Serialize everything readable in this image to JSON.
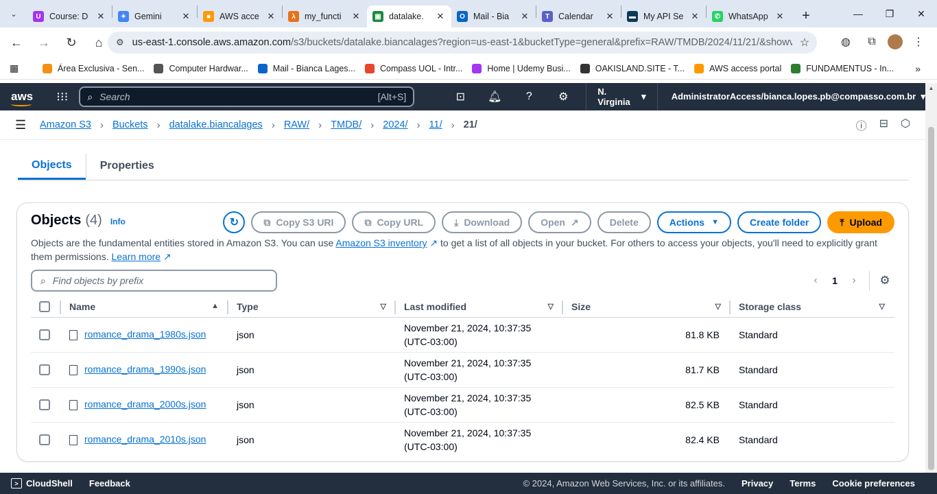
{
  "browser": {
    "tabs": [
      {
        "title": "Course: D",
        "color": "#a435f0",
        "glyph": "U"
      },
      {
        "title": "Gemini",
        "color": "#4285f4",
        "glyph": "✦"
      },
      {
        "title": "AWS acce",
        "color": "#ff9900",
        "glyph": "■"
      },
      {
        "title": "my_functi",
        "color": "#e7711b",
        "glyph": "λ"
      },
      {
        "title": "datalake.",
        "color": "#1b8a3e",
        "glyph": "▣"
      },
      {
        "title": "Mail - Bia",
        "color": "#0a64c8",
        "glyph": "O"
      },
      {
        "title": "Calendar",
        "color": "#5b5fc7",
        "glyph": "T"
      },
      {
        "title": "My API Se",
        "color": "#0c3b57",
        "glyph": "▬"
      },
      {
        "title": "WhatsApp",
        "color": "#25d366",
        "glyph": "✆"
      }
    ],
    "url_main": "us-east-1.console.aws.amazon.com",
    "url_rest": "/s3/buckets/datalake.biancalages?region=us-east-1&bucketType=general&prefix=RAW/TMDB/2024/11/21/&showve...",
    "bookmarks": [
      {
        "label": "Área Exclusiva - Sen...",
        "color": "#f29111"
      },
      {
        "label": "Computer Hardwar...",
        "color": "#555555"
      },
      {
        "label": "Mail - Bianca Lages...",
        "color": "#0a64c8"
      },
      {
        "label": "Compass UOL - Intr...",
        "color": "#e8452c"
      },
      {
        "label": "Home | Udemy Busi...",
        "color": "#a435f0"
      },
      {
        "label": "OAKISLAND.SITE - T...",
        "color": "#333333"
      },
      {
        "label": "AWS access portal",
        "color": "#ff9900"
      },
      {
        "label": "FUNDAMENTUS - In...",
        "color": "#2e7d32"
      }
    ]
  },
  "aws": {
    "logo": "aws",
    "search_placeholder": "Search",
    "search_shortcut": "[Alt+S]",
    "region": "N. Virginia",
    "account": "AdministratorAccess/bianca.lopes.pb@compasso.com.br"
  },
  "breadcrumbs": [
    "Amazon S3",
    "Buckets",
    "datalake.biancalages",
    "RAW/",
    "TMDB/",
    "2024/",
    "11/"
  ],
  "breadcrumb_current": "21/",
  "page_tabs": [
    "Objects",
    "Properties"
  ],
  "objects_panel": {
    "title": "Objects",
    "count": "(4)",
    "info": "Info",
    "buttons": {
      "copy_s3_uri": "Copy S3 URI",
      "copy_url": "Copy URL",
      "download": "Download",
      "open": "Open",
      "delete": "Delete",
      "actions": "Actions",
      "create_folder": "Create folder",
      "upload": "Upload"
    },
    "desc_1": "Objects are the fundamental entities stored in Amazon S3. You can use ",
    "desc_link_1": "Amazon S3 inventory",
    "desc_2": " to get a list of all objects in your bucket. For others to access your objects, you'll need to explicitly grant them permissions. ",
    "desc_link_2": "Learn more",
    "filter_placeholder": "Find objects by prefix",
    "page": "1",
    "columns": {
      "name": "Name",
      "type": "Type",
      "last_modified": "Last modified",
      "size": "Size",
      "storage_class": "Storage class"
    },
    "rows": [
      {
        "name": "romance_drama_1980s.json",
        "type": "json",
        "modified_1": "November 21, 2024, 10:37:35",
        "modified_2": "(UTC-03:00)",
        "size": "81.8 KB",
        "storage": "Standard"
      },
      {
        "name": "romance_drama_1990s.json",
        "type": "json",
        "modified_1": "November 21, 2024, 10:37:35",
        "modified_2": "(UTC-03:00)",
        "size": "81.7 KB",
        "storage": "Standard"
      },
      {
        "name": "romance_drama_2000s.json",
        "type": "json",
        "modified_1": "November 21, 2024, 10:37:35",
        "modified_2": "(UTC-03:00)",
        "size": "82.5 KB",
        "storage": "Standard"
      },
      {
        "name": "romance_drama_2010s.json",
        "type": "json",
        "modified_1": "November 21, 2024, 10:37:35",
        "modified_2": "(UTC-03:00)",
        "size": "82.4 KB",
        "storage": "Standard"
      }
    ]
  },
  "footer": {
    "cloudshell": "CloudShell",
    "feedback": "Feedback",
    "copyright": "© 2024, Amazon Web Services, Inc. or its affiliates.",
    "privacy": "Privacy",
    "terms": "Terms",
    "cookies": "Cookie preferences"
  }
}
